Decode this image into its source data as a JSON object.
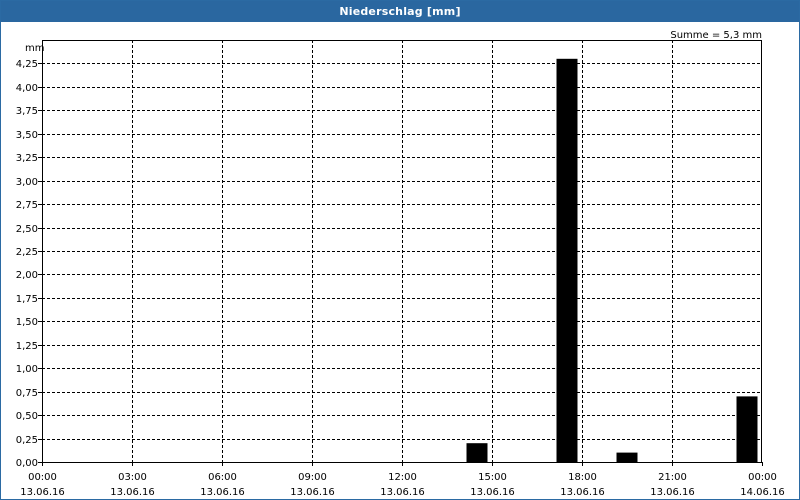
{
  "window": {
    "title": "Niederschlag [mm]"
  },
  "chart_data": {
    "type": "bar",
    "ylabel": "mm",
    "annotation": "Summe = 5,3 mm",
    "ylim": [
      0,
      4.5
    ],
    "yticks": [
      0,
      0.25,
      0.5,
      0.75,
      1.0,
      1.25,
      1.5,
      1.75,
      2.0,
      2.25,
      2.5,
      2.75,
      3.0,
      3.25,
      3.5,
      3.75,
      4.0,
      4.25
    ],
    "ytick_labels": [
      "0,00",
      "0,25",
      "0,50",
      "0,75",
      "1,00",
      "1,25",
      "1,50",
      "1,75",
      "2,00",
      "2,25",
      "2,50",
      "2,75",
      "3,00",
      "3,25",
      "3,50",
      "3,75",
      "4,00",
      "4,25"
    ],
    "xlim_hours": [
      0,
      24
    ],
    "xticks_hours": [
      0,
      3,
      6,
      9,
      12,
      15,
      18,
      21,
      24
    ],
    "xtick_labels": [
      [
        "00:00",
        "13.06.16"
      ],
      [
        "03:00",
        "13.06.16"
      ],
      [
        "06:00",
        "13.06.16"
      ],
      [
        "09:00",
        "13.06.16"
      ],
      [
        "12:00",
        "13.06.16"
      ],
      [
        "15:00",
        "13.06.16"
      ],
      [
        "18:00",
        "13.06.16"
      ],
      [
        "21:00",
        "13.06.16"
      ],
      [
        "00:00",
        "14.06.16"
      ]
    ],
    "bar_width_hours": 0.7,
    "bars": [
      {
        "x_hour": 14.5,
        "value": 0.2
      },
      {
        "x_hour": 17.5,
        "value": 4.3
      },
      {
        "x_hour": 19.5,
        "value": 0.1
      },
      {
        "x_hour": 23.5,
        "value": 0.7
      }
    ],
    "grid": true,
    "bar_color": "#000000"
  }
}
